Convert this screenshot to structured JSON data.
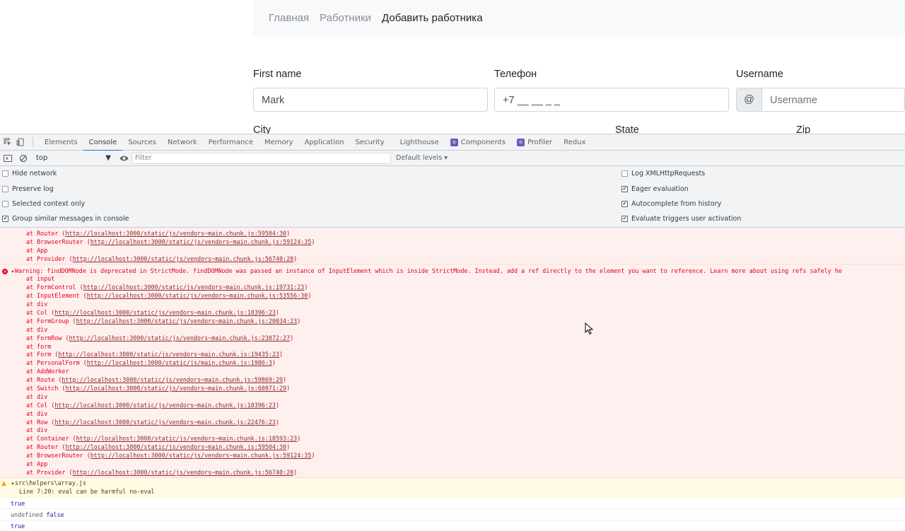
{
  "page": {
    "nav": [
      "Главная",
      "Работники",
      "Добавить работника"
    ],
    "form": {
      "first_name_label": "First name",
      "first_name_value": "Mark",
      "phone_label": "Телефон",
      "phone_value": "+7 __ __ _ _",
      "username_label": "Username",
      "username_prefix": "@",
      "username_placeholder": "Username",
      "city_label": "City",
      "state_label": "State",
      "zip_label": "Zip"
    }
  },
  "devtools": {
    "tabs": [
      "Elements",
      "Console",
      "Sources",
      "Network",
      "Performance",
      "Memory",
      "Application",
      "Security",
      "Lighthouse",
      "Components",
      "Profiler",
      "Redux"
    ],
    "active_tab": "Console",
    "toolbar": {
      "context": "top",
      "filter_placeholder": "Filter",
      "levels": "Default levels ▾"
    },
    "settings_left": [
      {
        "label": "Hide network",
        "checked": false
      },
      {
        "label": "Preserve log",
        "checked": false
      },
      {
        "label": "Selected context only",
        "checked": false
      },
      {
        "label": "Group similar messages in console",
        "checked": true
      }
    ],
    "settings_right": [
      {
        "label": "Log XMLHttpRequests",
        "checked": false
      },
      {
        "label": "Eager evaluation",
        "checked": true
      },
      {
        "label": "Autocomplete from history",
        "checked": true
      },
      {
        "label": "Evaluate triggers user activation",
        "checked": true
      }
    ],
    "console": {
      "prev_tail": [
        {
          "text": "at Router (",
          "url": "http://localhost:3000/static/js/vendors~main.chunk.js:59504:30"
        },
        {
          "text": "at BrowserRouter (",
          "url": "http://localhost:3000/static/js/vendors~main.chunk.js:59124:35"
        },
        {
          "text": "at App",
          "url": ""
        },
        {
          "text": "at Provider (",
          "url": "http://localhost:3000/static/js/vendors~main.chunk.js:56740:20"
        }
      ],
      "error_message": "▸Warning: findDOMNode is deprecated in StrictMode. findDOMNode was passed an instance of InputElement which is inside StrictMode. Instead, add a ref directly to the element you want to reference. Learn more about using refs safely he",
      "stack": [
        {
          "text": "at input",
          "url": ""
        },
        {
          "text": "at FormControl (",
          "url": "http://localhost:3000/static/js/vendors~main.chunk.js:19731:23"
        },
        {
          "text": "at InputElement (",
          "url": "http://localhost:3000/static/js/vendors~main.chunk.js:53556:30"
        },
        {
          "text": "at div",
          "url": ""
        },
        {
          "text": "at Col (",
          "url": "http://localhost:3000/static/js/vendors~main.chunk.js:18396:23"
        },
        {
          "text": "at FormGroup (",
          "url": "http://localhost:3000/static/js/vendors~main.chunk.js:20034:23"
        },
        {
          "text": "at div",
          "url": ""
        },
        {
          "text": "at FormRow (",
          "url": "http://localhost:3000/static/js/vendors~main.chunk.js:23872:27"
        },
        {
          "text": "at form",
          "url": ""
        },
        {
          "text": "at Form (",
          "url": "http://localhost:3000/static/js/vendors~main.chunk.js:19435:23"
        },
        {
          "text": "at PersonalForm (",
          "url": "http://localhost:3000/static/js/main.chunk.js:1986:3"
        },
        {
          "text": "at AddWorker",
          "url": ""
        },
        {
          "text": "at Route (",
          "url": "http://localhost:3000/static/js/vendors~main.chunk.js:59869:29"
        },
        {
          "text": "at Switch (",
          "url": "http://localhost:3000/static/js/vendors~main.chunk.js:60071:29"
        },
        {
          "text": "at div",
          "url": ""
        },
        {
          "text": "at Col (",
          "url": "http://localhost:3000/static/js/vendors~main.chunk.js:18396:23"
        },
        {
          "text": "at div",
          "url": ""
        },
        {
          "text": "at Row (",
          "url": "http://localhost:3000/static/js/vendors~main.chunk.js:22476:23"
        },
        {
          "text": "at div",
          "url": ""
        },
        {
          "text": "at Container (",
          "url": "http://localhost:3000/static/js/vendors~main.chunk.js:18593:23"
        },
        {
          "text": "at Router (",
          "url": "http://localhost:3000/static/js/vendors~main.chunk.js:59504:30"
        },
        {
          "text": "at BrowserRouter (",
          "url": "http://localhost:3000/static/js/vendors~main.chunk.js:59124:35"
        },
        {
          "text": "at App",
          "url": ""
        },
        {
          "text": "at Provider (",
          "url": "http://localhost:3000/static/js/vendors~main.chunk.js:56740:20"
        }
      ],
      "warning": {
        "file": "▸src\\helpers\\array.js",
        "detail": "Line 7:20:  eval can be harmful  no-eval"
      },
      "outputs": [
        {
          "a": "true",
          "b": ""
        },
        {
          "a": "undefined",
          "b": "false"
        },
        {
          "a": "true",
          "b": ""
        }
      ]
    }
  }
}
